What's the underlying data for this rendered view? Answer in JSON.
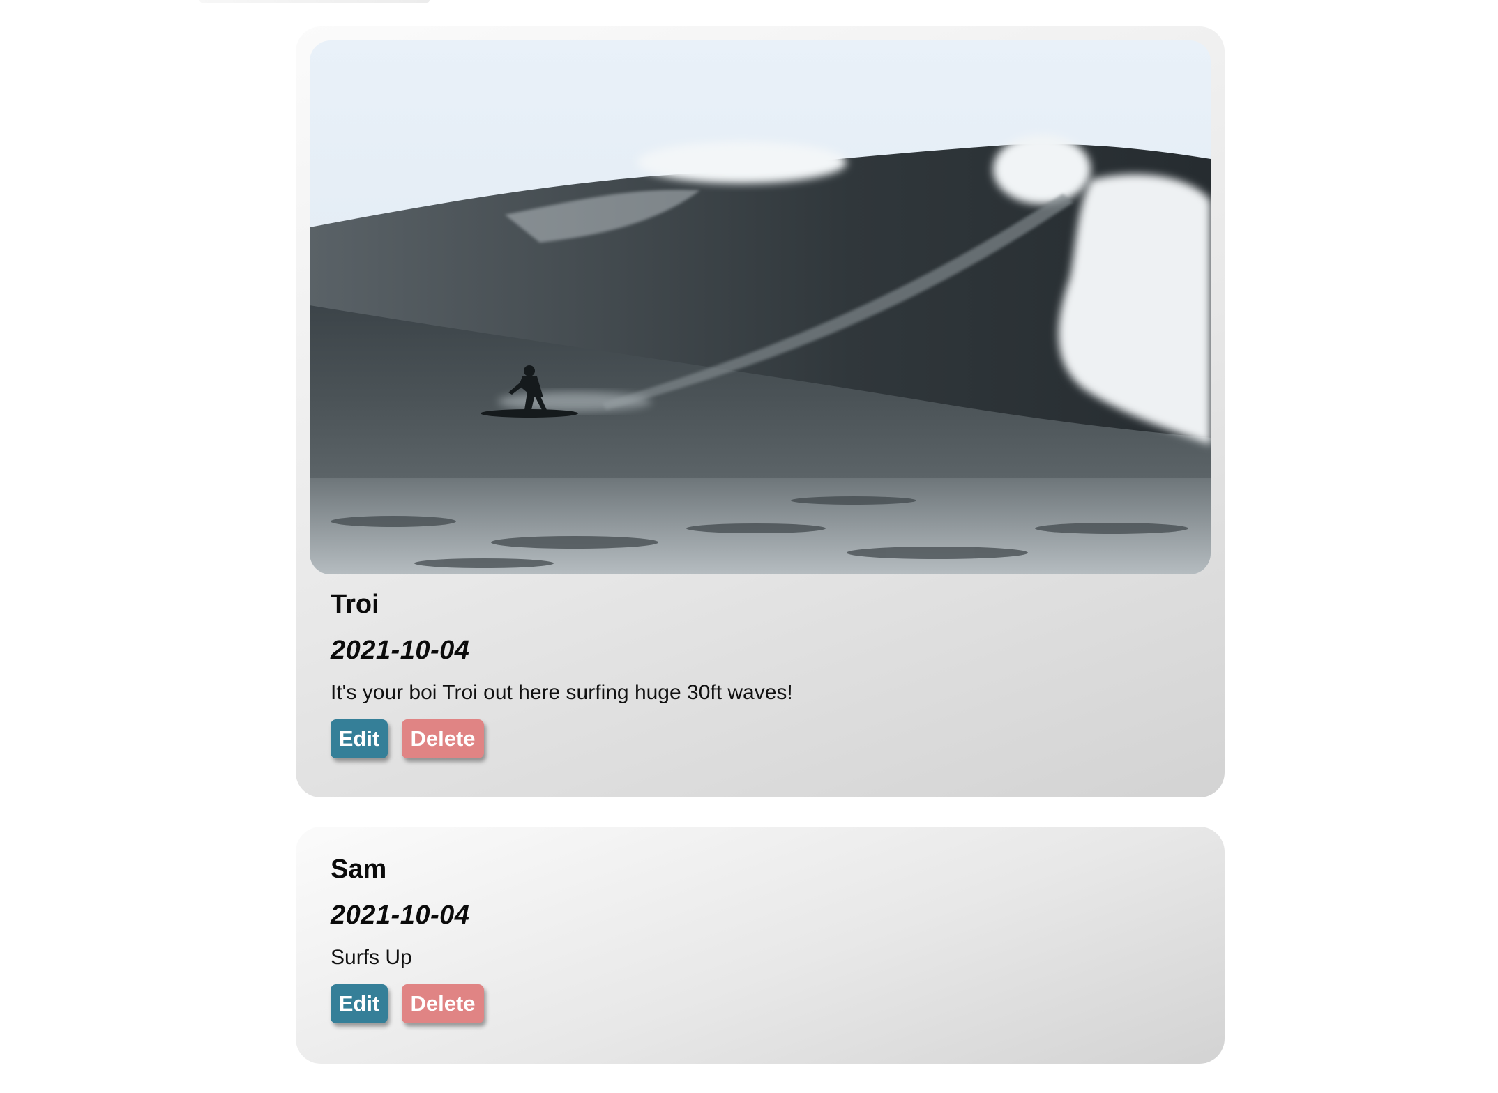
{
  "posts": [
    {
      "author": "Troi",
      "date": "2021-10-04",
      "text": "It's your boi Troi out here surfing huge 30ft waves!",
      "has_image": true,
      "edit_label": "Edit",
      "delete_label": "Delete"
    },
    {
      "author": "Sam",
      "date": "2021-10-04",
      "text": "Surfs Up",
      "has_image": false,
      "edit_label": "Edit",
      "delete_label": "Delete"
    }
  ],
  "colors": {
    "edit_button": "#357f98",
    "delete_button": "#e08484"
  }
}
